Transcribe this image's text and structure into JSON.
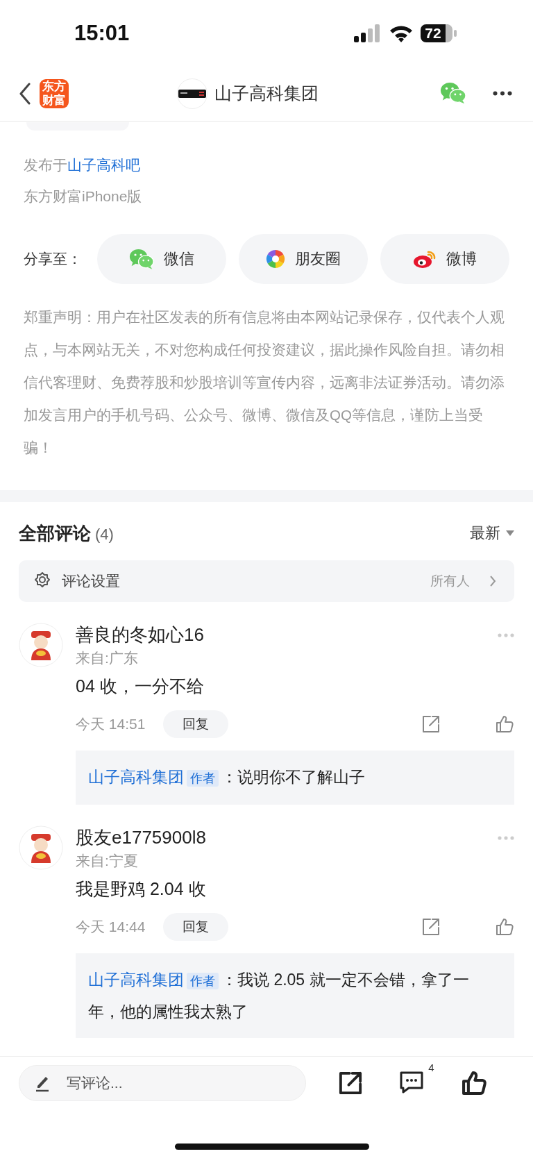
{
  "status_bar": {
    "time": "15:01",
    "battery": "72"
  },
  "nav": {
    "logo": "东方财富",
    "title": "山子高科集团"
  },
  "post": {
    "published_prefix": "发布于",
    "forum": "山子高科吧",
    "source": "东方财富iPhone版"
  },
  "share": {
    "label": "分享至：",
    "targets": [
      {
        "kind": "wechat",
        "label": "微信"
      },
      {
        "kind": "moments",
        "label": "朋友圈"
      },
      {
        "kind": "weibo",
        "label": "微博"
      }
    ]
  },
  "disclaimer": "郑重声明：用户在社区发表的所有信息将由本网站记录保存，仅代表个人观点，与本网站无关，不对您构成任何投资建议，据此操作风险自担。请勿相信代客理财、免费荐股和炒股培训等宣传内容，远离非法证券活动。请勿添加发言用户的手机号码、公众号、微博、微信及QQ等信息，谨防上当受骗！",
  "comments": {
    "title": "全部评论",
    "count": "(4)",
    "sort": "最新",
    "settings": {
      "label": "评论设置",
      "value": "所有人"
    },
    "items": [
      {
        "user": "善良的冬如心16",
        "location": "来自:广东",
        "text": "04 收，一分不给",
        "time": "今天 14:51",
        "reply_button": "回复",
        "replies": [
          {
            "author": "山子高科集团",
            "badge": "作者",
            "separator": "：",
            "text": "说明你不了解山子"
          }
        ]
      },
      {
        "user": "股友e1775900l8",
        "location": "来自:宁夏",
        "text": "我是野鸡 2.04 收",
        "time": "今天 14:44",
        "reply_button": "回复",
        "replies": [
          {
            "author": "山子高科集团",
            "badge": "作者",
            "separator": "：",
            "text": "我说 2.05 就一定不会错，拿了一年，他的属性我太熟了"
          }
        ]
      }
    ]
  },
  "bottom_bar": {
    "placeholder": "写评论...",
    "comment_count": "4"
  }
}
